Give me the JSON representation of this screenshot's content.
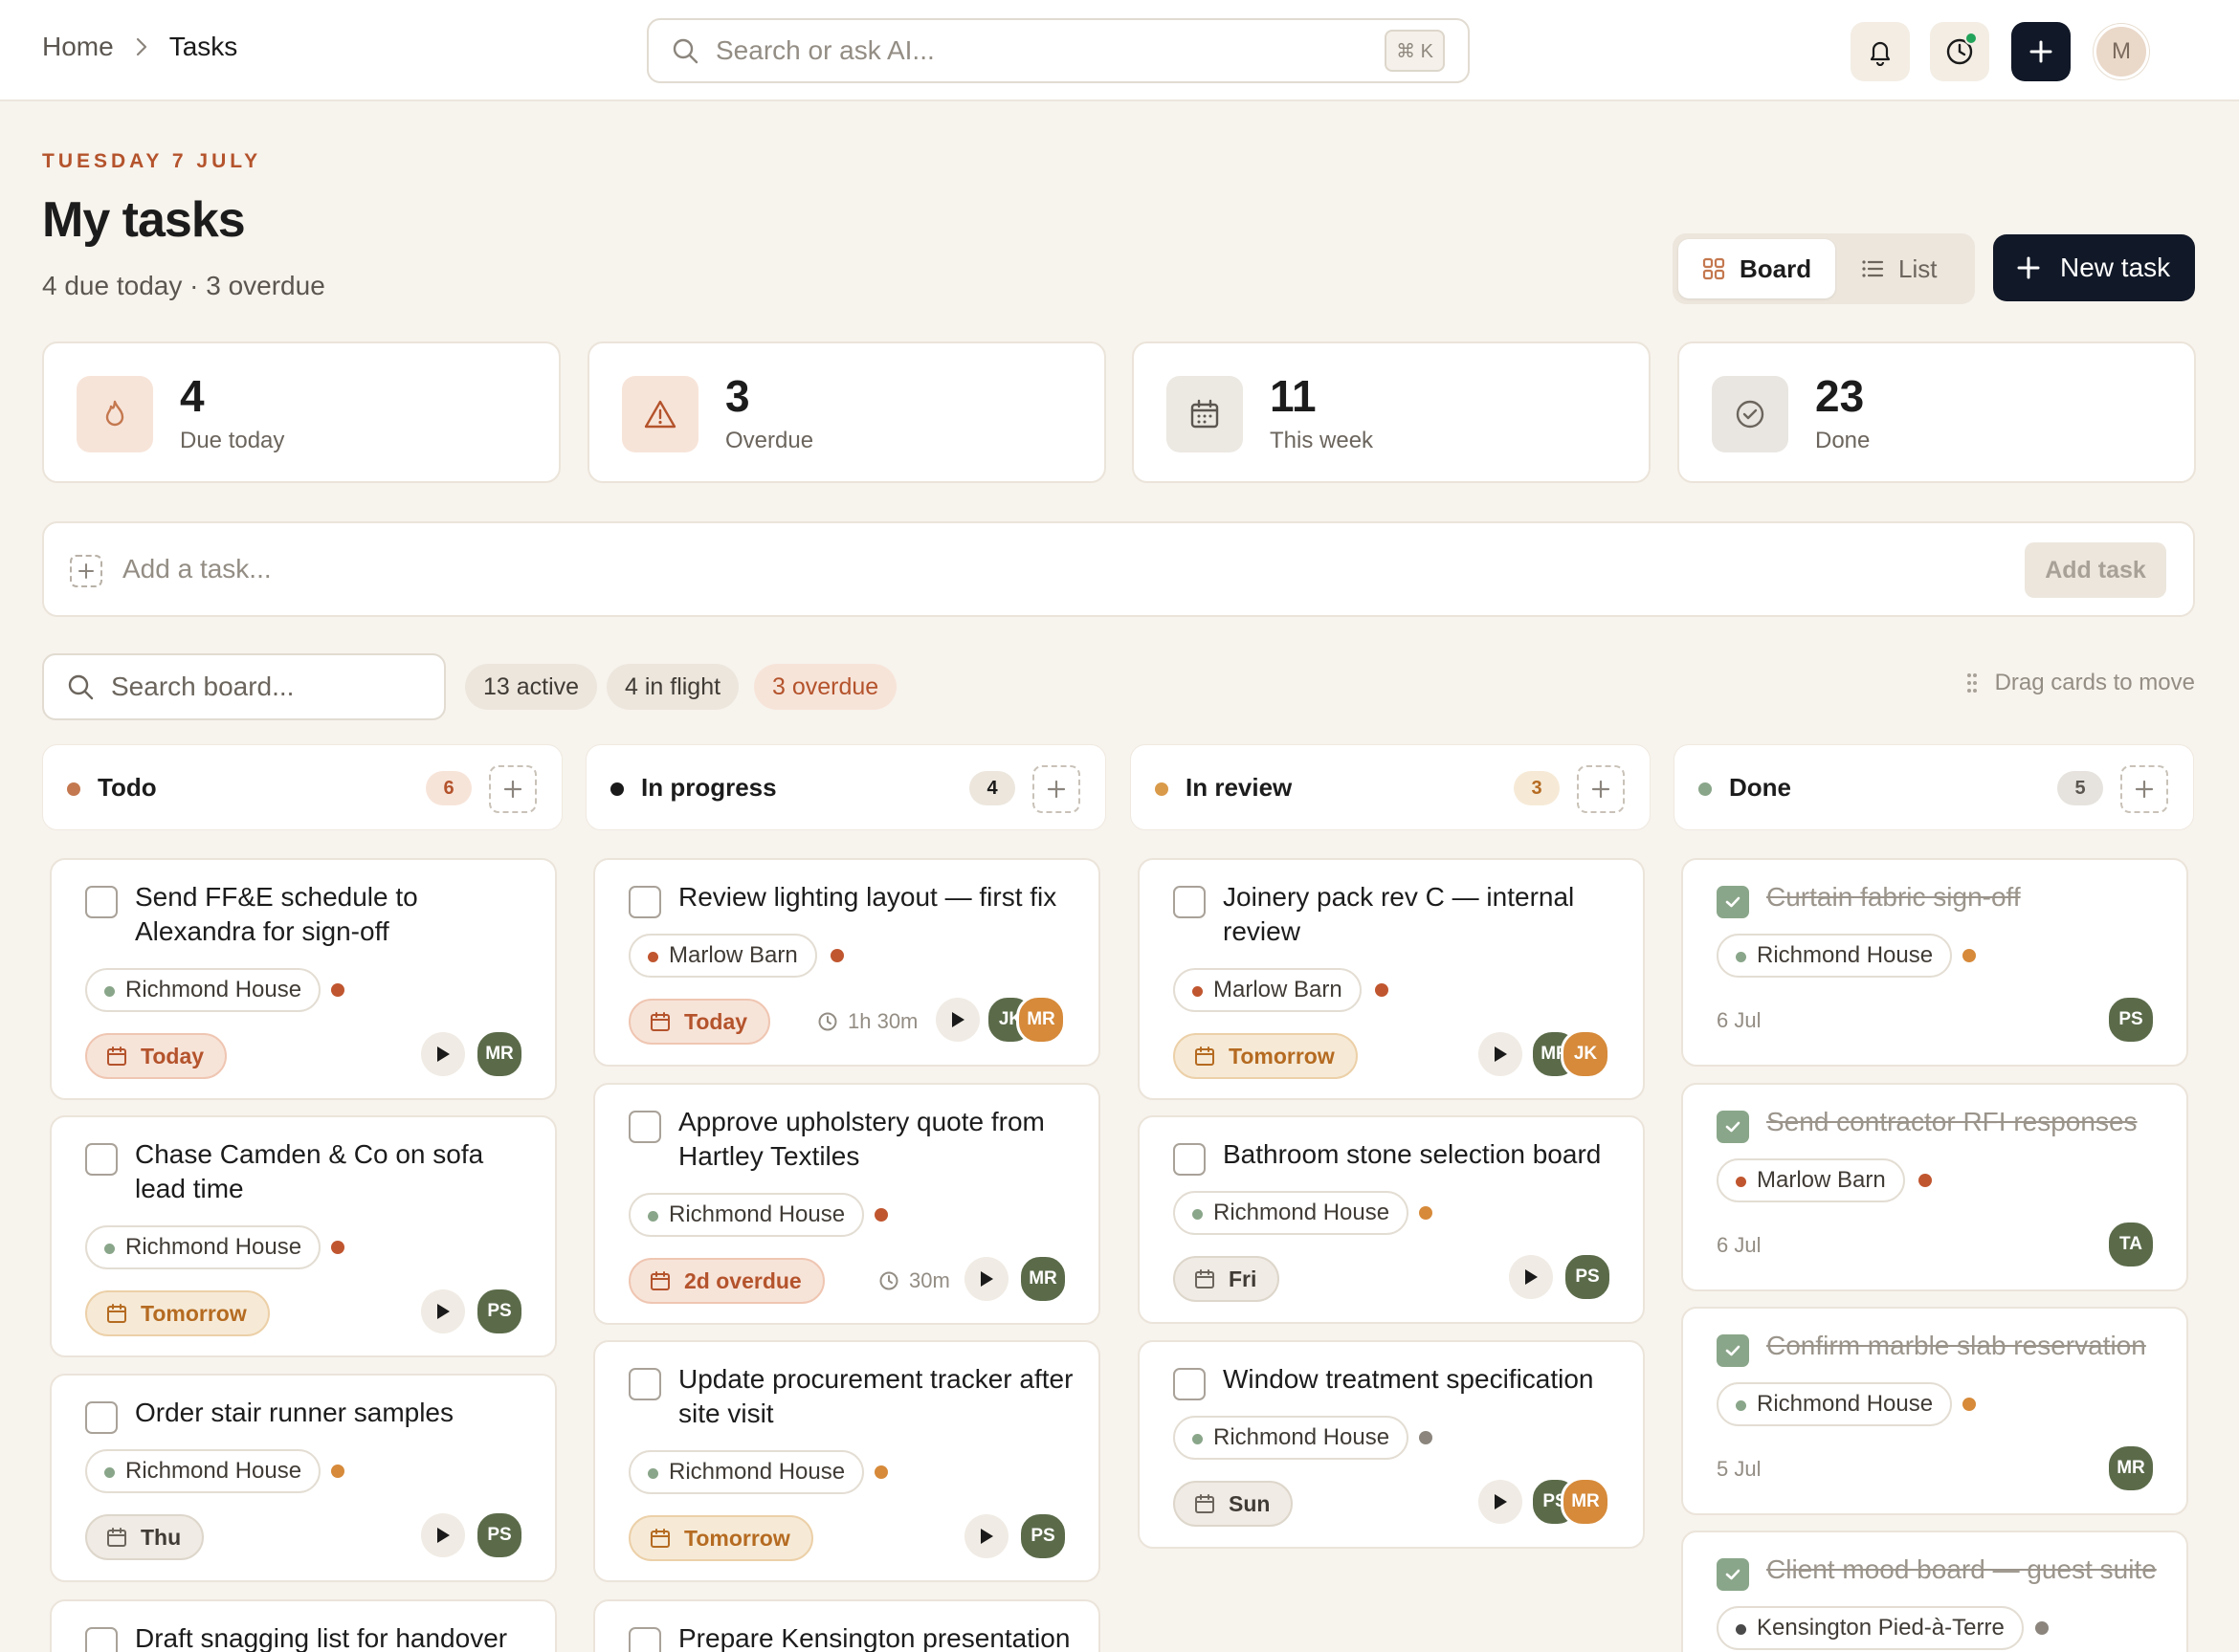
{
  "breadcrumb": {
    "home": "Home",
    "separator": "›",
    "current": "Tasks"
  },
  "search": {
    "placeholder": "Search or ask AI...",
    "shortcut": "⌘ K"
  },
  "user": {
    "initial": "M"
  },
  "header": {
    "date": "TUESDAY 7 JULY",
    "title": "My tasks",
    "subtitle": "4 due today · 3 overdue"
  },
  "view_toggle": {
    "board": "Board",
    "list": "List",
    "selected": "Board"
  },
  "new_task_label": "New task",
  "stats": [
    {
      "value": "4",
      "label": "Due today",
      "icon": "flame-icon"
    },
    {
      "value": "3",
      "label": "Overdue",
      "icon": "warning-icon"
    },
    {
      "value": "11",
      "label": "This week",
      "icon": "calendar-icon"
    },
    {
      "value": "23",
      "label": "Done",
      "icon": "check-circle-icon"
    }
  ],
  "add_task": {
    "placeholder": "Add a task...",
    "button": "Add task"
  },
  "board_search": {
    "placeholder": "Search board..."
  },
  "chips": {
    "active": "13 active",
    "in_flight": "4 in flight",
    "overdue": "3 overdue"
  },
  "drag_hint": "Drag cards to move",
  "colors": {
    "accent": "#b4532c",
    "dark": "#111827",
    "amber": "#d68a3a",
    "sage": "#8aa68a",
    "background": "#f7f3ed"
  },
  "columns": [
    {
      "name": "Todo",
      "count": "6",
      "dot": "#c4784f"
    },
    {
      "name": "In progress",
      "count": "4",
      "dot": "#1a1a1a"
    },
    {
      "name": "In review",
      "count": "3",
      "dot": "#d99a4a"
    },
    {
      "name": "Done",
      "count": "5",
      "dot": "#8aa68a"
    }
  ],
  "cards": {
    "todo": [
      {
        "title": "Send FF&E schedule to Alexandra for sign-off",
        "project": "Richmond House",
        "priority": "high",
        "due": "Today",
        "assignees": [
          "MR"
        ]
      },
      {
        "title": "Chase Camden & Co on sofa lead time",
        "project": "Richmond House",
        "priority": "high",
        "due": "Tomorrow",
        "assignees": [
          "PS"
        ]
      },
      {
        "title": "Order stair runner samples",
        "project": "Richmond House",
        "priority": "medium",
        "due": "Thu",
        "assignees": [
          "PS"
        ]
      },
      {
        "title": "Draft snagging list for handover"
      }
    ],
    "in_progress": [
      {
        "title": "Review lighting layout — first fix",
        "project": "Marlow Barn",
        "priority": "high",
        "due": "Today",
        "timer": "1h 30m",
        "assignees": [
          "JK",
          "MR"
        ]
      },
      {
        "title": "Approve upholstery quote from Hartley Textiles",
        "project": "Richmond House",
        "priority": "high",
        "due": "2d overdue",
        "timer": "30m",
        "assignees": [
          "MR"
        ]
      },
      {
        "title": "Update procurement tracker after site visit",
        "project": "Richmond House",
        "priority": "medium",
        "due": "Tomorrow",
        "assignees": [
          "PS"
        ]
      },
      {
        "title": "Prepare Kensington presentation"
      }
    ],
    "in_review": [
      {
        "title": "Joinery pack rev C — internal review",
        "project": "Marlow Barn",
        "priority": "high",
        "due": "Tomorrow",
        "assignees": [
          "MR",
          "JK"
        ]
      },
      {
        "title": "Bathroom stone selection board",
        "project": "Richmond House",
        "priority": "medium",
        "due": "Fri",
        "assignees": [
          "PS"
        ]
      },
      {
        "title": "Window treatment specification",
        "project": "Richmond House",
        "priority": "low",
        "due": "Sun",
        "assignees": [
          "PS",
          "MR"
        ]
      }
    ],
    "done": [
      {
        "title": "Curtain fabric sign-off",
        "project": "Richmond House",
        "priority": "medium",
        "date": "6 Jul",
        "assignees": [
          "PS"
        ]
      },
      {
        "title": "Send contractor RFI responses",
        "project": "Marlow Barn",
        "priority": "high",
        "date": "6 Jul",
        "assignees": [
          "TA"
        ]
      },
      {
        "title": "Confirm marble slab reservation",
        "project": "Richmond House",
        "priority": "medium",
        "date": "5 Jul",
        "assignees": [
          "MR"
        ]
      },
      {
        "title": "Client mood board — guest suite",
        "project": "Kensington Pied-à-Terre",
        "priority": "low"
      }
    ]
  }
}
